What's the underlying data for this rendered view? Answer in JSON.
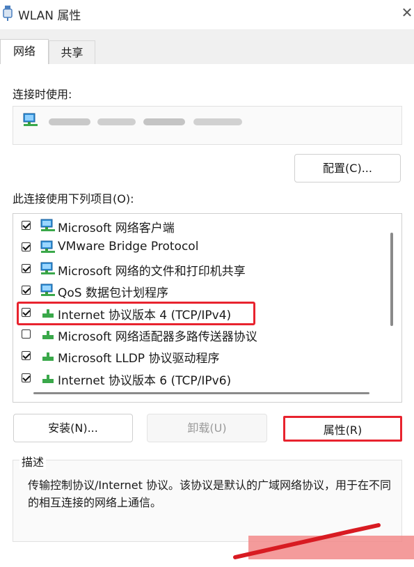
{
  "window": {
    "title": "WLAN 属性",
    "close_glyph": "✕"
  },
  "tabs": [
    {
      "label": "网络",
      "active": true
    },
    {
      "label": "共享",
      "active": false
    }
  ],
  "connection": {
    "label": "连接时使用:",
    "adapter_name_blurred": true
  },
  "buttons": {
    "configure": "配置(C)...",
    "install": "安装(N)...",
    "uninstall": "卸载(U)",
    "properties": "属性(R)"
  },
  "items_label": "此连接使用下列项目(O):",
  "items": [
    {
      "label": "Microsoft 网络客户端",
      "checked": true,
      "icon": "network-client-icon"
    },
    {
      "label": "VMware Bridge Protocol",
      "checked": true,
      "icon": "network-client-icon"
    },
    {
      "label": "Microsoft 网络的文件和打印机共享",
      "checked": true,
      "icon": "network-client-icon"
    },
    {
      "label": "QoS 数据包计划程序",
      "checked": true,
      "icon": "network-client-icon"
    },
    {
      "label": "Internet 协议版本 4 (TCP/IPv4)",
      "checked": true,
      "icon": "protocol-icon"
    },
    {
      "label": "Microsoft 网络适配器多路传送器协议",
      "checked": false,
      "icon": "protocol-icon"
    },
    {
      "label": "Microsoft LLDP 协议驱动程序",
      "checked": true,
      "icon": "protocol-icon"
    },
    {
      "label": "Internet 协议版本 6 (TCP/IPv6)",
      "checked": true,
      "icon": "protocol-icon"
    }
  ],
  "description": {
    "title": "描述",
    "text": "传输控制协议/Internet 协议。该协议是默认的广域网络协议，用于在不同的相互连接的网络上通信。"
  },
  "colors": {
    "highlight_red": "#e8232e",
    "pink_overlay": "#f28a8a",
    "window_bg": "#ffffff",
    "tab_strip_bg": "#f0f0f0"
  }
}
